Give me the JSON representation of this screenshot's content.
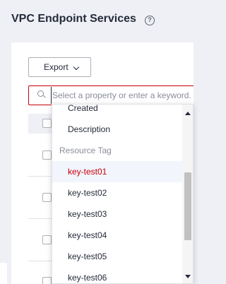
{
  "page": {
    "title": "VPC Endpoint Services",
    "help_icon_glyph": "?"
  },
  "toolbar": {
    "export_label": "Export"
  },
  "search": {
    "placeholder": "Select a property or enter a keyword."
  },
  "dropdown": {
    "items_before_group": [
      "Created",
      "Description"
    ],
    "group_label": "Resource Tag",
    "tag_items": [
      "key-test01",
      "key-test02",
      "key-test03",
      "key-test04",
      "key-test05",
      "key-test06"
    ],
    "selected_item": "key-test01"
  },
  "colors": {
    "accent": "#c7000b",
    "page_bg": "#eef0f5",
    "table_header_bg": "#eef0f5",
    "selected_bg": "#f2f5fc",
    "group_label": "#8a8e99"
  },
  "icons": {
    "help": "help-circle-icon",
    "search": "search-icon",
    "export_chevron": "chevron-down-icon",
    "scroll_up": "caret-up-icon",
    "scroll_down": "caret-down-icon"
  }
}
